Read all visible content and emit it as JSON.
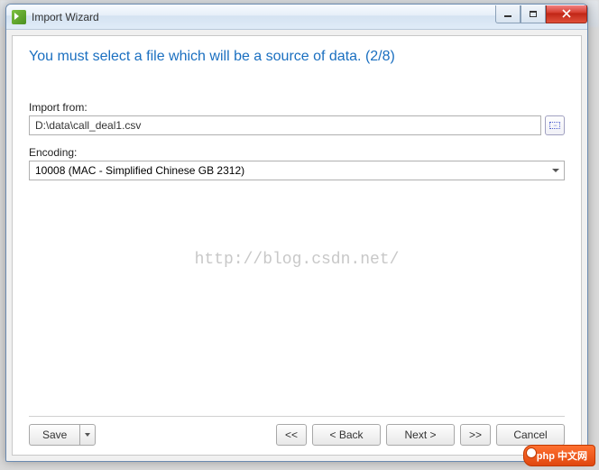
{
  "window": {
    "title": "Import Wizard"
  },
  "step": {
    "heading": "You must select a file which will be a source of data. (2/8)"
  },
  "fields": {
    "import_from_label": "Import from:",
    "import_from_value": "D:\\data\\call_deal1.csv",
    "encoding_label": "Encoding:",
    "encoding_value": "10008 (MAC - Simplified Chinese GB 2312)"
  },
  "watermark": "http://blog.csdn.net/",
  "footer": {
    "save": "Save",
    "first": "<<",
    "back": "<  Back",
    "next": "Next  >",
    "last": ">>",
    "cancel": "Cancel"
  },
  "badge": "php 中文网"
}
